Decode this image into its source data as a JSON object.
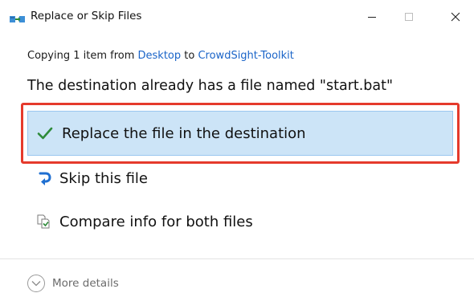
{
  "window": {
    "title": "Replace or Skip Files",
    "app_icon": "file-copy-icon",
    "controls": {
      "minimize": "minimize-icon",
      "maximize": "maximize-icon",
      "close": "close-icon"
    }
  },
  "copy_status": {
    "prefix": "Copying 1 item from ",
    "source": "Desktop",
    "middle": " to ",
    "destination": "CrowdSight-Toolkit"
  },
  "headline": "The destination already has a file named \"start.bat\"",
  "options": {
    "replace": {
      "label": "Replace the file in the destination",
      "icon": "checkmark-icon"
    },
    "skip": {
      "label": "Skip this file",
      "icon": "skip-arrow-icon"
    },
    "compare": {
      "label": "Compare info for both files",
      "icon": "compare-files-icon"
    }
  },
  "footer": {
    "more_details": "More details",
    "icon": "chevron-down-circle-icon"
  },
  "colors": {
    "link": "#1a64c8",
    "selection_bg": "#cce4f7",
    "highlight_border": "#e53a2c",
    "check_green": "#2e8b3a"
  }
}
